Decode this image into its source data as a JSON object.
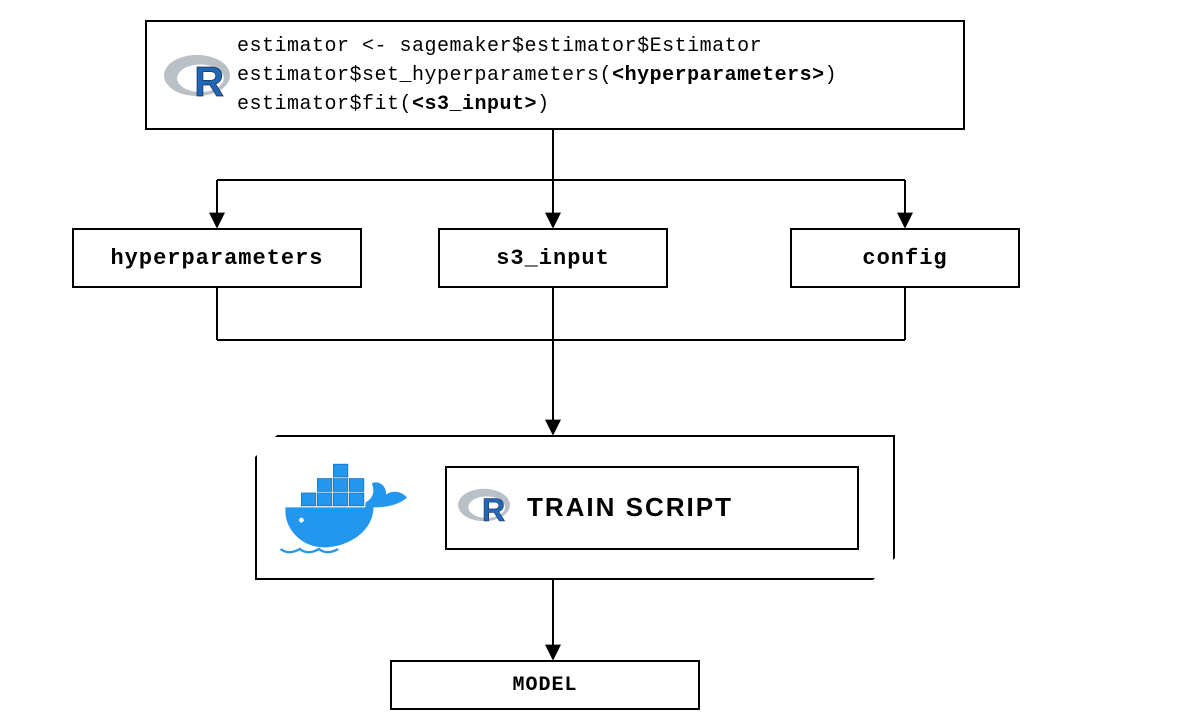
{
  "code": {
    "line1_a": "estimator <- sagemaker$estimator$Estimator",
    "line2_a": "estimator$set_hyperparameters(",
    "line2_b": "<hyperparameters>",
    "line2_c": ")",
    "line3_a": "estimator$fit(",
    "line3_b": "<s3_input>",
    "line3_c": ")"
  },
  "mid": {
    "hyper": "hyperparameters",
    "s3": "s3_input",
    "config": "config"
  },
  "container": {
    "train_label": "TRAIN SCRIPT"
  },
  "model": {
    "label": "MODEL"
  },
  "icons": {
    "r_logo": "R-language logo",
    "docker": "Docker whale logo"
  },
  "colors": {
    "r_blue": "#2266b4",
    "r_ring": "#b9c0c6",
    "docker_blue": "#2396ed"
  }
}
